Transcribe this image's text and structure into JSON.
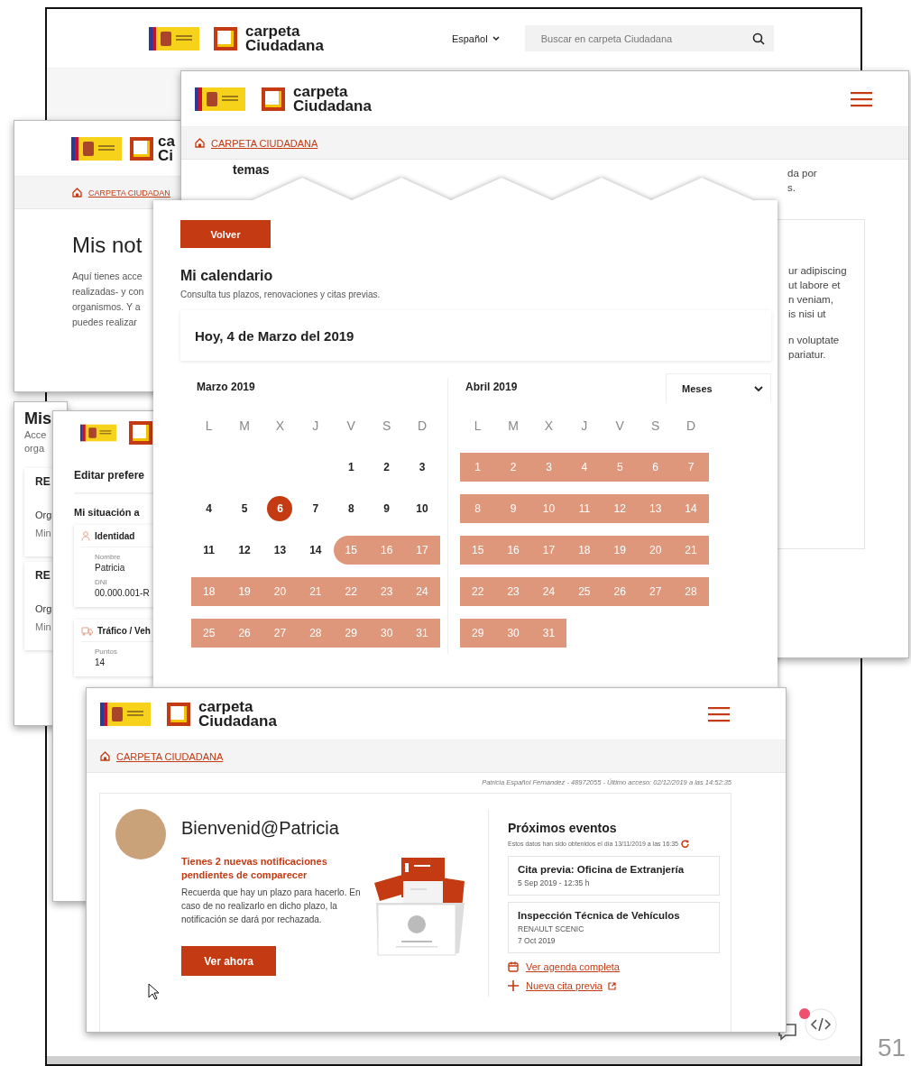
{
  "back_window": {
    "logo": {
      "line1": "carpeta",
      "line2": "Ciudadana"
    },
    "language": "Español",
    "search": {
      "placeholder": "Buscar en carpeta Ciudadana"
    }
  },
  "notifications_window": {
    "logo": {
      "line1": "ca",
      "line2": "Ci"
    },
    "breadcrumb": "CARPETA CIUDADAN",
    "title": "Mis not",
    "text_lines": [
      "Aquí tienes acce",
      "realizadas- y con",
      "organismos. Y a",
      "puedes realizar"
    ]
  },
  "topics_window": {
    "logo": {
      "line1": "carpeta",
      "line2": "Ciudadana"
    },
    "breadcrumb": "CARPETA CIUDADANA",
    "title": "temas",
    "intro_lines": [
      "da por",
      "s."
    ],
    "card_paragraphs": [
      [
        "ur adipiscing",
        "ut labore et",
        "n veniam,",
        "is nisi ut"
      ],
      [
        "n voluptate",
        "pariatur."
      ]
    ]
  },
  "registry_window": {
    "title": "Mis",
    "text_lines": [
      "Acce",
      "orga"
    ],
    "cards": [
      {
        "heading": "RE",
        "lines": [
          "Org",
          "Min"
        ]
      },
      {
        "heading": "RE",
        "lines": [
          "Org",
          "Min"
        ]
      }
    ]
  },
  "preferences_window": {
    "title": "Editar prefere",
    "subtitle": "Mi situación a",
    "sections": [
      {
        "kind": "identity",
        "title": "Identidad",
        "fields": [
          {
            "label": "Nombre",
            "value": "Patricia"
          },
          {
            "label": "DNI",
            "value": "00.000.001-R"
          }
        ]
      },
      {
        "kind": "vehicle",
        "title": "Tráfico / Veh",
        "fields": [
          {
            "label": "Puntos",
            "value": "14"
          }
        ]
      }
    ]
  },
  "calendar_window": {
    "back_button": "Volver",
    "title": "Mi calendario",
    "subtitle": "Consulta tus plazos, renovaciones y citas previas.",
    "today": "Hoy, 4 de Marzo del 2019",
    "view_select": "Meses",
    "months": [
      {
        "name": "Marzo 2019",
        "weekdays": [
          "L",
          "M",
          "X",
          "J",
          "V",
          "S",
          "D"
        ],
        "weeks": [
          [
            {
              "d": "1",
              "in_range": false,
              "today": false
            },
            {
              "d": "2",
              "in_range": false,
              "today": false
            },
            {
              "d": "3",
              "in_range": false,
              "today": false
            }
          ],
          [
            {
              "d": "4",
              "in_range": false,
              "today": false
            },
            {
              "d": "5",
              "in_range": false,
              "today": false
            },
            {
              "d": "6",
              "in_range": false,
              "today": true
            },
            {
              "d": "7",
              "in_range": false,
              "today": false
            },
            {
              "d": "8",
              "in_range": false,
              "today": false
            },
            {
              "d": "9",
              "in_range": false,
              "today": false
            },
            {
              "d": "10",
              "in_range": false,
              "today": false
            }
          ],
          [
            {
              "d": "11",
              "in_range": false,
              "today": false
            },
            {
              "d": "12",
              "in_range": false,
              "today": false
            },
            {
              "d": "13",
              "in_range": false,
              "today": false
            },
            {
              "d": "14",
              "in_range": false,
              "today": false
            },
            {
              "d": "15",
              "in_range": true,
              "today": false
            },
            {
              "d": "16",
              "in_range": true,
              "today": false
            },
            {
              "d": "17",
              "in_range": true,
              "today": false
            }
          ],
          [
            {
              "d": "18",
              "in_range": true,
              "today": false
            },
            {
              "d": "19",
              "in_range": true,
              "today": false
            },
            {
              "d": "20",
              "in_range": true,
              "today": false
            },
            {
              "d": "21",
              "in_range": true,
              "today": false
            },
            {
              "d": "22",
              "in_range": true,
              "today": false
            },
            {
              "d": "23",
              "in_range": true,
              "today": false
            },
            {
              "d": "24",
              "in_range": true,
              "today": false
            }
          ],
          [
            {
              "d": "25",
              "in_range": true,
              "today": false
            },
            {
              "d": "26",
              "in_range": true,
              "today": false
            },
            {
              "d": "27",
              "in_range": true,
              "today": false
            },
            {
              "d": "28",
              "in_range": true,
              "today": false
            },
            {
              "d": "29",
              "in_range": true,
              "today": false
            },
            {
              "d": "30",
              "in_range": true,
              "today": false
            },
            {
              "d": "31",
              "in_range": true,
              "today": false
            }
          ]
        ]
      },
      {
        "name": "Abril 2019",
        "weekdays": [
          "L",
          "M",
          "X",
          "J",
          "V",
          "S",
          "D"
        ],
        "weeks": [
          [
            {
              "d": "1",
              "in_range": true,
              "today": false
            },
            {
              "d": "2",
              "in_range": true,
              "today": false
            },
            {
              "d": "3",
              "in_range": true,
              "today": false
            },
            {
              "d": "4",
              "in_range": true,
              "today": false
            },
            {
              "d": "5",
              "in_range": true,
              "today": false
            },
            {
              "d": "6",
              "in_range": true,
              "today": false
            },
            {
              "d": "7",
              "in_range": true,
              "today": false
            }
          ],
          [
            {
              "d": "8",
              "in_range": true,
              "today": false
            },
            {
              "d": "9",
              "in_range": true,
              "today": false
            },
            {
              "d": "10",
              "in_range": true,
              "today": false
            },
            {
              "d": "11",
              "in_range": true,
              "today": false
            },
            {
              "d": "12",
              "in_range": true,
              "today": false
            },
            {
              "d": "13",
              "in_range": true,
              "today": false
            },
            {
              "d": "14",
              "in_range": true,
              "today": false
            }
          ],
          [
            {
              "d": "15",
              "in_range": true,
              "today": false
            },
            {
              "d": "16",
              "in_range": true,
              "today": false
            },
            {
              "d": "17",
              "in_range": true,
              "today": false
            },
            {
              "d": "18",
              "in_range": true,
              "today": false
            },
            {
              "d": "19",
              "in_range": true,
              "today": false
            },
            {
              "d": "20",
              "in_range": true,
              "today": false
            },
            {
              "d": "21",
              "in_range": true,
              "today": false
            }
          ],
          [
            {
              "d": "22",
              "in_range": true,
              "today": false
            },
            {
              "d": "23",
              "in_range": true,
              "today": false
            },
            {
              "d": "24",
              "in_range": true,
              "today": false
            },
            {
              "d": "25",
              "in_range": true,
              "today": false
            },
            {
              "d": "26",
              "in_range": true,
              "today": false
            },
            {
              "d": "27",
              "in_range": true,
              "today": false
            },
            {
              "d": "28",
              "in_range": true,
              "today": false
            }
          ],
          [
            {
              "d": "29",
              "in_range": true,
              "today": false
            },
            {
              "d": "30",
              "in_range": true,
              "today": false
            },
            {
              "d": "31",
              "in_range": true,
              "today": false
            }
          ]
        ]
      }
    ]
  },
  "home_window": {
    "logo": {
      "line1": "carpeta",
      "line2": "Ciudadana"
    },
    "breadcrumb": "CARPETA CIUDADANA",
    "user_info": "Patricia Español Fernández - 48972055 - Último acceso: 02/12/2019 a las 14:52:35",
    "greeting": "Bienvenid@Patricia",
    "alert": "Tienes 2 nuevas notificaciones pendientes de comparecer",
    "message": "Recuerda que hay un plazo para hacerlo. En caso de no realizarlo en dicho plazo, la notificación se dará por rechazada.",
    "action_button": "Ver ahora",
    "events_title": "Próximos eventos",
    "events_note": "Estos datos han sido obtenidos el día 13/11/2019 a las 16:35",
    "events": [
      {
        "title": "Cita previa: Oficina de Extranjería",
        "lines": [
          "5 Sep 2019 - 12:35 h"
        ]
      },
      {
        "title": "Inspección Técnica de Vehículos",
        "lines": [
          "RENAULT SCENIC",
          "7 Oct 2019"
        ]
      }
    ],
    "links": [
      {
        "kind": "calendar",
        "label": "Ver agenda completa",
        "external": false
      },
      {
        "kind": "add",
        "label": "Nueva cita previa",
        "external": true
      }
    ]
  },
  "slide_number": "51"
}
